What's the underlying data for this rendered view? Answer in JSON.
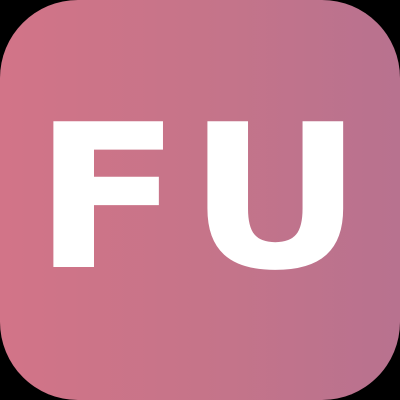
{
  "app_icon": {
    "monogram": "FU",
    "colors": {
      "background": "#000000",
      "gradient_start": "#d27488",
      "gradient_mid": "#c67489",
      "gradient_end": "#b8728f",
      "text": "#ffffff"
    }
  }
}
